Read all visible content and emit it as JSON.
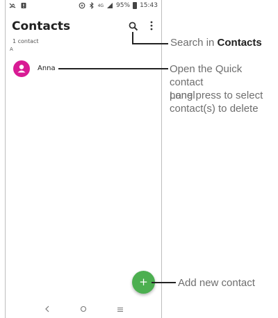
{
  "statusbar": {
    "battery": "95%",
    "time": "15:43",
    "network": "4G"
  },
  "app": {
    "title": "Contacts",
    "contact_count": "1 contact",
    "section_letter": "A"
  },
  "contacts": [
    {
      "name": "Anna",
      "avatar_color": "#d81b94"
    }
  ],
  "fab": {
    "symbol": "+",
    "color": "#4caf50"
  },
  "callouts": {
    "search_prefix": "Search in ",
    "search_bold": "Contacts",
    "quick_panel_line1": "Open the Quick contact",
    "quick_panel_line2": "panel",
    "long_press_line1": "Long press to select",
    "long_press_line2": "contact(s) to delete",
    "add_contact": "Add new contact"
  },
  "icons": [
    "missed-call-icon",
    "notification-icon",
    "data-saver-icon",
    "bluetooth-icon",
    "signal-icon",
    "battery-icon",
    "search-icon",
    "more-options-icon",
    "person-icon",
    "back-icon",
    "home-icon",
    "recents-icon"
  ]
}
